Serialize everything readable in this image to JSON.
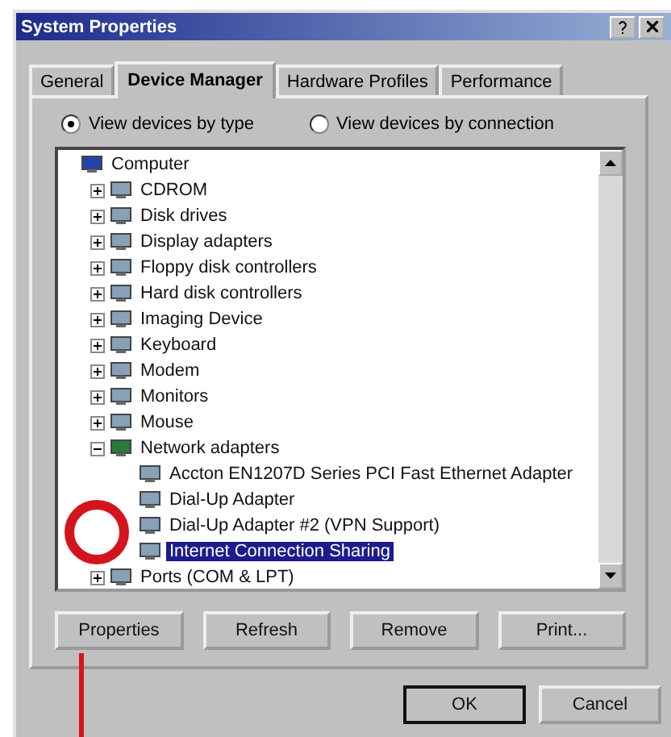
{
  "window": {
    "title": "System Properties"
  },
  "tabs": [
    {
      "label": "General",
      "selected": false
    },
    {
      "label": "Device Manager",
      "selected": true
    },
    {
      "label": "Hardware Profiles",
      "selected": false
    },
    {
      "label": "Performance",
      "selected": false
    }
  ],
  "view_options": [
    {
      "label": "View devices by type",
      "selected": true
    },
    {
      "label": "View devices by connection",
      "selected": false
    }
  ],
  "device_tree": [
    {
      "label": "Computer",
      "selected": false,
      "children": [
        {
          "label": "CDROM",
          "expanded": false,
          "selected": false
        },
        {
          "label": "Disk drives",
          "expanded": false,
          "selected": false
        },
        {
          "label": "Display adapters",
          "expanded": false,
          "selected": false
        },
        {
          "label": "Floppy disk controllers",
          "expanded": false,
          "selected": false
        },
        {
          "label": "Hard disk controllers",
          "expanded": false,
          "selected": false
        },
        {
          "label": "Imaging Device",
          "expanded": false,
          "selected": false
        },
        {
          "label": "Keyboard",
          "expanded": false,
          "selected": false
        },
        {
          "label": "Modem",
          "expanded": false,
          "selected": false
        },
        {
          "label": "Monitors",
          "expanded": false,
          "selected": false
        },
        {
          "label": "Mouse",
          "expanded": false,
          "selected": false
        },
        {
          "label": "Network adapters",
          "expanded": true,
          "selected": false,
          "children": [
            {
              "label": "Accton EN1207D Series PCI Fast Ethernet Adapter",
              "selected": false
            },
            {
              "label": "Dial-Up Adapter",
              "selected": false
            },
            {
              "label": "Dial-Up Adapter #2 (VPN Support)",
              "selected": false
            },
            {
              "label": "Internet Connection Sharing",
              "selected": true
            }
          ]
        },
        {
          "label": "Ports (COM & LPT)",
          "expanded": false,
          "selected": false
        }
      ]
    }
  ],
  "actions": [
    "Properties",
    "Refresh",
    "Remove",
    "Print..."
  ],
  "buttons": [
    "OK",
    "Cancel"
  ]
}
